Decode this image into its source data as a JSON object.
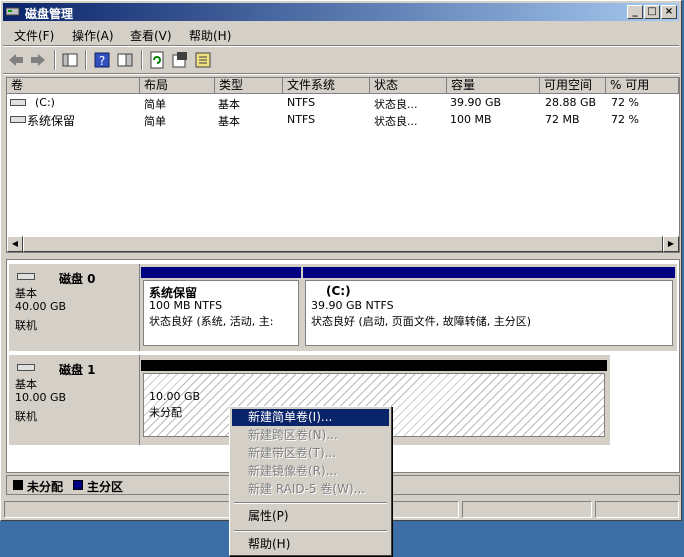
{
  "window": {
    "title": "磁盘管理"
  },
  "menubar": [
    "文件(F)",
    "操作(A)",
    "查看(V)",
    "帮助(H)"
  ],
  "volume_list": {
    "columns": [
      "卷",
      "布局",
      "类型",
      "文件系统",
      "状态",
      "容量",
      "可用空间",
      "% 可用"
    ],
    "rows": [
      [
        "(C:)",
        "简单",
        "基本",
        "NTFS",
        "状态良...",
        "39.90 GB",
        "28.88 GB",
        "72 %"
      ],
      [
        "系统保留",
        "简单",
        "基本",
        "NTFS",
        "状态良...",
        "100 MB",
        "72 MB",
        "72 %"
      ]
    ]
  },
  "disks": [
    {
      "name": "磁盘 0",
      "type": "基本",
      "size": "40.00 GB",
      "state": "联机",
      "partitions": [
        {
          "name": "系统保留",
          "size_fs": "100 MB NTFS",
          "status": "状态良好 (系统, 活动, 主:"
        },
        {
          "name": "(C:)",
          "size_fs": "39.90 GB NTFS",
          "status": "状态良好 (启动, 页面文件, 故障转储, 主分区)"
        }
      ]
    },
    {
      "name": "磁盘 1",
      "type": "基本",
      "size": "10.00 GB",
      "state": "联机",
      "partitions": [
        {
          "size": "10.00 GB",
          "status": "未分配"
        }
      ]
    }
  ],
  "legend": {
    "unallocated": "未分配",
    "primary": "主分区"
  },
  "context_menu": {
    "items": [
      "新建简单卷(I)...",
      "新建跨区卷(N)...",
      "新建带区卷(T)...",
      "新建镜像卷(R)...",
      "新建 RAID-5 卷(W)...",
      "属性(P)",
      "帮助(H)"
    ]
  },
  "colors": {
    "primary_partition": "#000080",
    "unallocated": "#000000",
    "title_bar": "#0a246a",
    "desktop": "#3a6ea5"
  }
}
